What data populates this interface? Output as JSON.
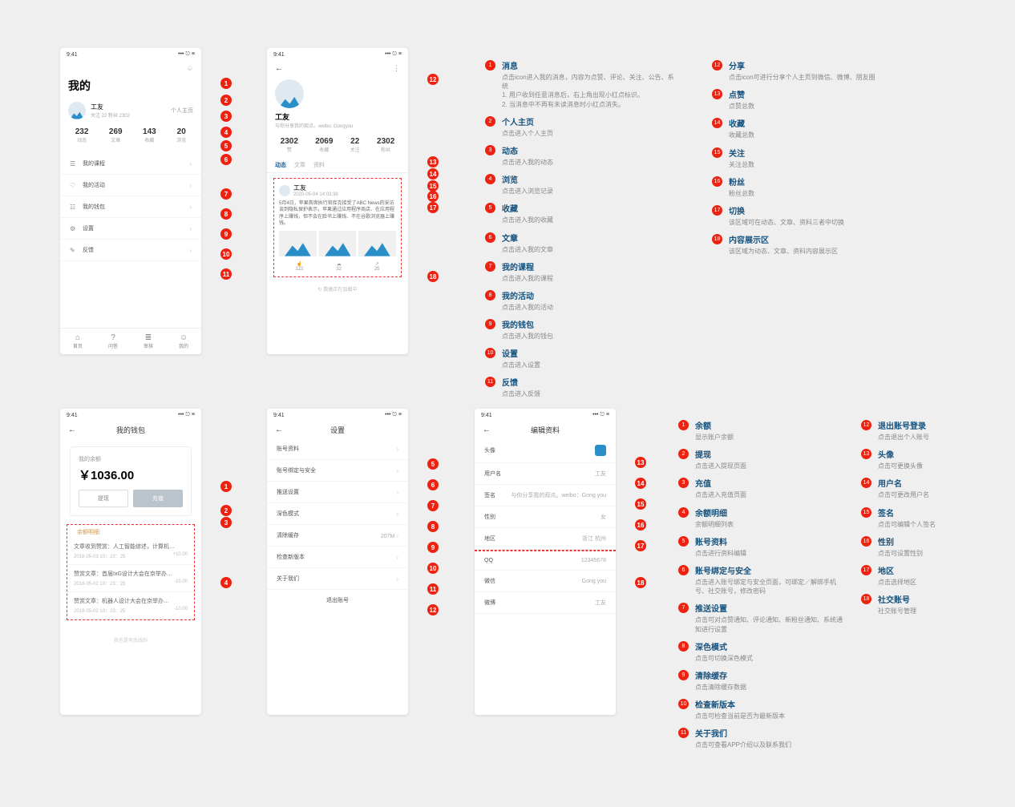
{
  "statusbar": {
    "time": "9:41",
    "signal": "••• ⎋ ≡"
  },
  "my": {
    "title": "我的",
    "username": "工友",
    "follow_meta": "关注 22   粉丝 2302",
    "homepage_link": "个人主页",
    "stats": [
      {
        "n": "232",
        "l": "动态"
      },
      {
        "n": "269",
        "l": "文章"
      },
      {
        "n": "143",
        "l": "收藏"
      },
      {
        "n": "20",
        "l": "浏览"
      }
    ],
    "menu": [
      {
        "icon": "☰",
        "label": "我的课程"
      },
      {
        "icon": "♡",
        "label": "我的活动"
      },
      {
        "icon": "☷",
        "label": "我的钱包"
      },
      {
        "icon": "⚙",
        "label": "设置"
      },
      {
        "icon": "✎",
        "label": "反馈"
      }
    ],
    "tabs": [
      {
        "icon": "⌂",
        "label": "首页"
      },
      {
        "icon": "?",
        "label": "问答"
      },
      {
        "icon": "≣",
        "label": "审核"
      },
      {
        "icon": "☺",
        "label": "我的"
      }
    ]
  },
  "profile": {
    "name": "工友",
    "bio": "与你分享我的观点。weibo: Gongyou",
    "stats": [
      {
        "n": "2302",
        "l": "赞"
      },
      {
        "n": "2069",
        "l": "收藏"
      },
      {
        "n": "22",
        "l": "关注"
      },
      {
        "n": "2302",
        "l": "粉丝"
      }
    ],
    "segtabs": [
      "动态",
      "文章",
      "资料"
    ],
    "post": {
      "author": "工友",
      "time": "2020-05-04 14:03:38",
      "body": "5月4日，苹果首席执行官库克接受了ABC News的采访谈到隐私保护表示，苹果通过应用程序商店、在应用程序上赚钱，但不会在脸书上赚钱、不在谷歌浏览器上赚钱。"
    },
    "engage": [
      {
        "icon": "☝",
        "n": "122"
      },
      {
        "icon": "☁",
        "n": "32"
      },
      {
        "icon": "↗",
        "n": "25"
      }
    ],
    "loading": "↻ 数据正在加载中"
  },
  "wallet": {
    "title": "我的钱包",
    "balance_label": "我的余额",
    "balance": "￥1036.00",
    "btn_withdraw": "提现",
    "btn_topup": "充值",
    "detail_title": "余额明细",
    "rows": [
      {
        "t": "文章收到赞赏：人工智能综述，计算机…",
        "d": "2018-05-03 10：23：25",
        "a": "+10.00"
      },
      {
        "t": "赞赏文章：首届IxG设计大会在京举办…",
        "d": "2018-05-02 10：23：25",
        "a": "-10.00"
      },
      {
        "t": "赞赏文章：机器人设计大会在京举办…",
        "d": "2018-05-02 10：23：25",
        "a": "-10.00"
      }
    ],
    "nomore": "我也是有底线的"
  },
  "settings": {
    "title": "设置",
    "items": [
      {
        "label": "账号资料",
        "val": ""
      },
      {
        "label": "账号绑定与安全",
        "val": ""
      },
      {
        "label": "推送设置",
        "val": ""
      },
      {
        "label": "深色模式",
        "val": ""
      },
      {
        "label": "清除缓存",
        "val": "207M"
      },
      {
        "label": "检查新版本",
        "val": ""
      },
      {
        "label": "关于我们",
        "val": ""
      }
    ],
    "logout": "退出账号"
  },
  "edit": {
    "title": "编辑资料",
    "items": [
      {
        "label": "头像",
        "val": ""
      },
      {
        "label": "用户名",
        "val": "工友"
      },
      {
        "label": "签名",
        "val": "与你分享我的观点。weibo：Gong you"
      },
      {
        "label": "性别",
        "val": "女"
      },
      {
        "label": "地区",
        "val": "浙江 杭州"
      },
      {
        "label": "QQ",
        "val": "12345678"
      },
      {
        "label": "微信",
        "val": "Gong you"
      },
      {
        "label": "微博",
        "val": "工友"
      }
    ]
  },
  "annotations_top_left": [
    {
      "n": 1,
      "t": "消息",
      "d": "点击icon进入我的消息，内容为点赞、评论、关注、公告、系统\n1. 用户收到任意消息后，右上角出现小红点标识。\n2. 当消息中不再有未读消息时小红点消失。"
    },
    {
      "n": 2,
      "t": "个人主页",
      "d": "点击进入个人主页"
    },
    {
      "n": 3,
      "t": "动态",
      "d": "点击进入我的动态"
    },
    {
      "n": 4,
      "t": "浏览",
      "d": "点击进入浏览记录"
    },
    {
      "n": 5,
      "t": "收藏",
      "d": "点击进入我的收藏"
    },
    {
      "n": 6,
      "t": "文章",
      "d": "点击进入我的文章"
    },
    {
      "n": 7,
      "t": "我的课程",
      "d": "点击进入我的课程"
    },
    {
      "n": 8,
      "t": "我的活动",
      "d": "点击进入我的活动"
    },
    {
      "n": 9,
      "t": "我的钱包",
      "d": "点击进入我的钱包"
    },
    {
      "n": 10,
      "t": "设置",
      "d": "点击进入设置"
    },
    {
      "n": 11,
      "t": "反馈",
      "d": "点击进入反馈"
    }
  ],
  "annotations_top_right": [
    {
      "n": 12,
      "t": "分享",
      "d": "点击icon可进行分享个人主页到微信、微博、朋友圈"
    },
    {
      "n": 13,
      "t": "点赞",
      "d": "点赞总数"
    },
    {
      "n": 14,
      "t": "收藏",
      "d": "收藏总数"
    },
    {
      "n": 15,
      "t": "关注",
      "d": "关注总数"
    },
    {
      "n": 16,
      "t": "粉丝",
      "d": "粉丝总数"
    },
    {
      "n": 17,
      "t": "切换",
      "d": "该区域可在动态、文章、资料三者中切换"
    },
    {
      "n": 18,
      "t": "内容展示区",
      "d": "该区域为动态、文章、资料内容展示区"
    }
  ],
  "annotations_bot_left": [
    {
      "n": 1,
      "t": "余额",
      "d": "显示账户余额"
    },
    {
      "n": 2,
      "t": "提现",
      "d": "点击进入提现页面"
    },
    {
      "n": 3,
      "t": "充值",
      "d": "点击进入充值页面"
    },
    {
      "n": 4,
      "t": "余额明细",
      "d": "余额明细列表"
    },
    {
      "n": 5,
      "t": "账号资料",
      "d": "点击进行资料编辑"
    },
    {
      "n": 6,
      "t": "账号绑定与安全",
      "d": "点击进入账号绑定与安全页面，可绑定／解绑手机号、社交账号，修改密码"
    },
    {
      "n": 7,
      "t": "推送设置",
      "d": "点击可对点赞通知、评论通知、新粉丝通知、系统通知进行设置"
    },
    {
      "n": 8,
      "t": "深色模式",
      "d": "点击可切换深色模式"
    },
    {
      "n": 9,
      "t": "清除缓存",
      "d": "点击清除缓存数据"
    },
    {
      "n": 10,
      "t": "检查新版本",
      "d": "点击可检查当前是否为最新版本"
    },
    {
      "n": 11,
      "t": "关于我们",
      "d": "点击可查看APP介绍以及联系我们"
    }
  ],
  "annotations_bot_right": [
    {
      "n": 12,
      "t": "退出账号登录",
      "d": "点击退出个人账号"
    },
    {
      "n": 13,
      "t": "头像",
      "d": "点击可更换头像"
    },
    {
      "n": 14,
      "t": "用户名",
      "d": "点击可更改用户名"
    },
    {
      "n": 15,
      "t": "签名",
      "d": "点击可编辑个人签名"
    },
    {
      "n": 16,
      "t": "性别",
      "d": "点击可设置性别"
    },
    {
      "n": 17,
      "t": "地区",
      "d": "点击选择地区"
    },
    {
      "n": 18,
      "t": "社交账号",
      "d": "社交账号管理"
    }
  ]
}
